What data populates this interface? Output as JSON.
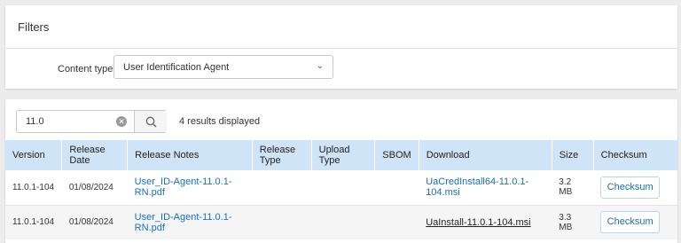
{
  "filters": {
    "title": "Filters",
    "content_type_label": "Content type",
    "content_type_value": "User Identification Agent"
  },
  "search": {
    "value": "11.0",
    "results_text": "4 results displayed"
  },
  "table": {
    "headers": [
      "Version",
      "Release Date",
      "Release Notes",
      "Release Type",
      "Upload Type",
      "SBOM",
      "Download",
      "Size",
      "Checksum"
    ],
    "rows": [
      {
        "version": "11.0.1-104",
        "release_date": "01/08/2024",
        "release_notes": "User_ID-Agent-11.0.1-RN.pdf",
        "release_type": "",
        "upload_type": "",
        "sbom": "",
        "download": "UaCredInstall64-11.0.1-104.msi",
        "size": "3.2 MB",
        "checksum": "Checksum"
      },
      {
        "version": "11.0.1-104",
        "release_date": "01/08/2024",
        "release_notes": "User_ID-Agent-11.0.1-RN.pdf",
        "release_type": "",
        "upload_type": "",
        "sbom": "",
        "download": "UaInstall-11.0.1-104.msi",
        "size": "3.3 MB",
        "checksum": "Checksum"
      }
    ]
  }
}
